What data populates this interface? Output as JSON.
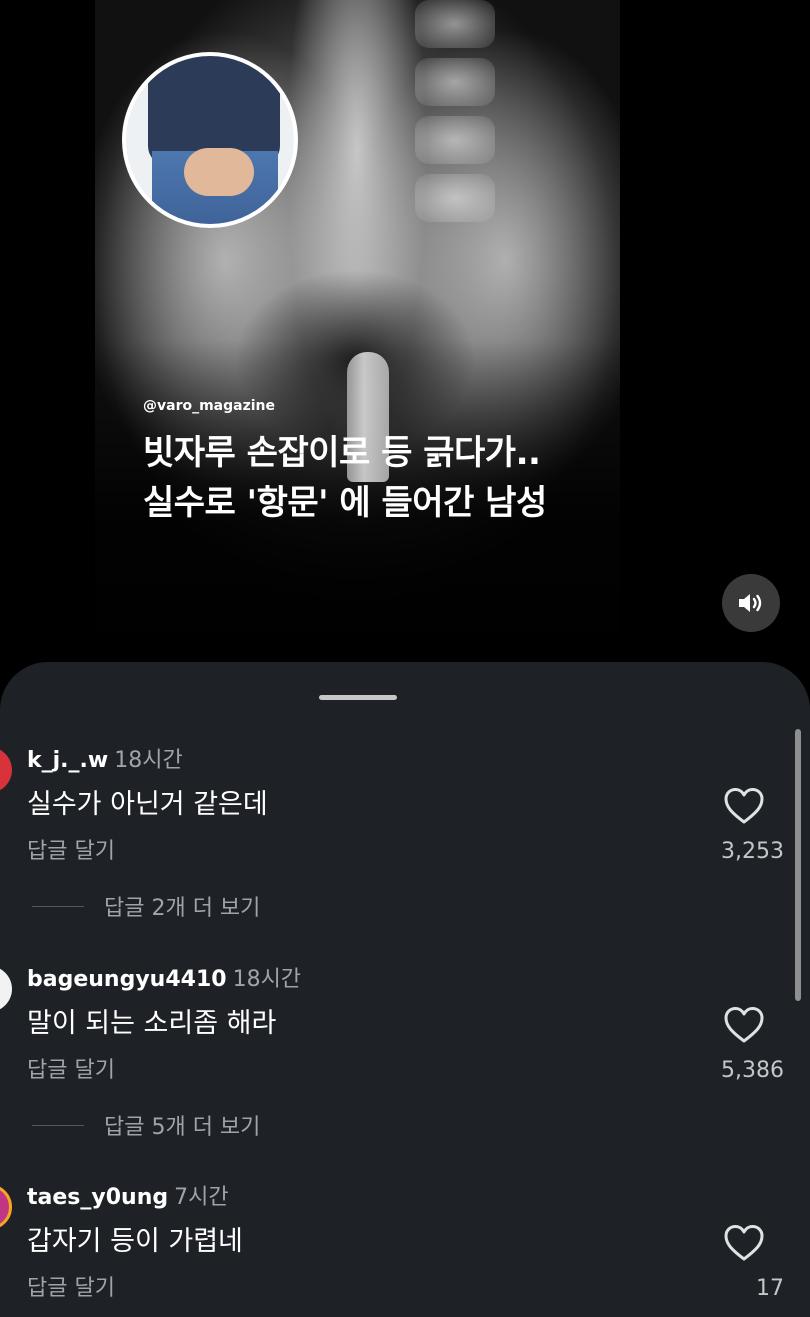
{
  "post": {
    "handle": "@varo_magazine",
    "headline_line1": "빗자루 손잡이로 등 긁다가..",
    "headline_line2": "실수로 '항문' 에 들어간 남성"
  },
  "icons": {
    "sound": "speaker-icon",
    "like": "heart-icon"
  },
  "colors": {
    "sheet_background": "#1e2226",
    "secondary_text": "#a0a4a8"
  },
  "comments": [
    {
      "username": "k_j._.w",
      "time": "18시간",
      "text": "실수가 아닌거 같은데",
      "reply_label": "답글 달기",
      "likes": "3,253",
      "view_replies": "답글 2개 더 보기",
      "avatar_color": "#d8323a"
    },
    {
      "username": "bageungyu4410",
      "time": "18시간",
      "text": "말이 되는 소리좀 해라",
      "reply_label": "답글 달기",
      "likes": "5,386",
      "view_replies": "답글 5개 더 보기",
      "avatar_color": "#f2f2f2"
    },
    {
      "username": "taes_y0ung",
      "time": "7시간",
      "text": "갑자기 등이 가렵네",
      "reply_label": "답글 달기",
      "likes": "17",
      "avatar_color": "#c13584"
    }
  ]
}
